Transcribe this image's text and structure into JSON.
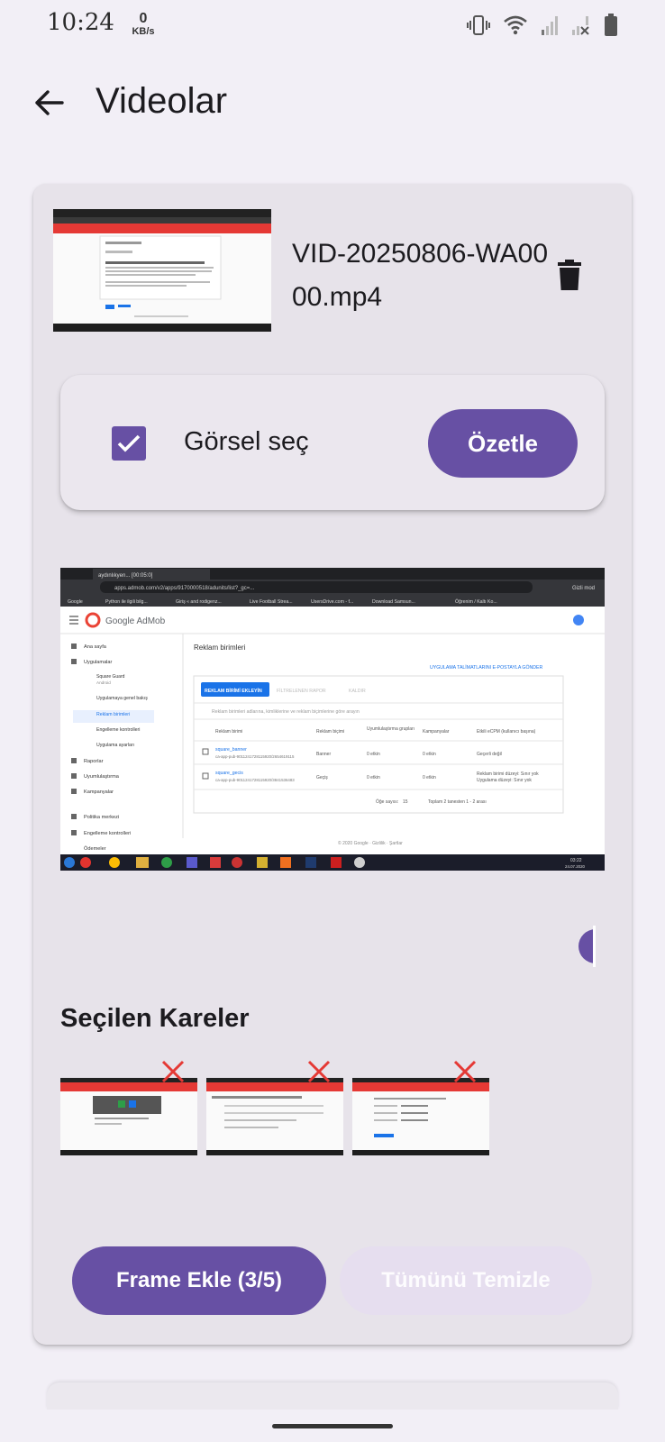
{
  "status_bar": {
    "time": "10:24",
    "net_speed_value": "0",
    "net_speed_unit": "KB/s",
    "icons": [
      "vibrate-icon",
      "wifi-icon",
      "signal-icon",
      "signal-no-service-icon",
      "battery-icon"
    ]
  },
  "app_bar": {
    "back_icon": "arrow-left-icon",
    "title": "Videolar"
  },
  "video": {
    "file_name": "VID-20250806-WA0000.mp4",
    "delete_icon": "trash-icon"
  },
  "select_panel": {
    "checkbox_checked": true,
    "checkbox_label": "Görsel seç",
    "summarize_label": "Özetle"
  },
  "frame_preview": {
    "browser_tab": "aydınlıkyen... [00:05:0]",
    "url": "apps.admob.com/v2/apps/9170000518/adunits/list?_gc=...",
    "bookmarks": [
      "Google",
      "Python ile ilgili bilg...",
      "Giriş « and rodigenz...",
      "Live Football Strea...",
      "UsersDrive.com - f...",
      "Download Samsun...",
      "Öğrenim / Kaltı Ko..."
    ],
    "logo_text": "Google AdMob",
    "profile_label": "Gizli mod",
    "nav_items": [
      "Ana sayfa",
      "Uygulamalar",
      "Square Guard",
      "Android",
      "Uygulamaya genel bakış",
      "Reklam birimleri",
      "Engelleme kontrolleri",
      "Uygulama ayarları",
      "Raporlar",
      "Uyumlulaştırma",
      "Kampanyalar",
      "Politika merkezi",
      "Engelleme kontrolleri",
      "Ödemeler"
    ],
    "page_title": "Reklam birimleri",
    "email_link": "UYGULAMA TALİMATLARINI E-POSTAYLA GÖNDER",
    "add_unit_button": "REKLAM BİRİMİ EKLEYİN",
    "filter_button": "FİLTRELENEN RAPOR",
    "delete_link": "KALDIR",
    "search_placeholder": "Reklam birimleri adlarına, kimliklerine ve reklam biçimlerine göre arayın",
    "columns": [
      "Reklam birimi",
      "Reklam biçimi",
      "Uyumlulaştırma grupları",
      "Kampanyalar",
      "Etkili eCPM (kullanıcı başına)"
    ],
    "rows": [
      [
        "square_banner",
        "ca-app-pub-9011241728115920/2654619115",
        "Banner",
        "0 etkin",
        "0 etkin",
        "Geçerli değil"
      ],
      [
        "square_gecis",
        "ca-app-pub-9011241728115920/3841536483",
        "Geçiş",
        "0 etkin",
        "0 etkin",
        "Reklam birimi düzeyi: Sınır yok"
      ]
    ],
    "row2_extra": "Uygulama düzeyi: Sınır yok",
    "per_page_label": "Öğe sayısı:",
    "per_page_value": "15",
    "pagination_text": "Toplam 2 tanesten 1 - 2 arası",
    "footer": "© 2020 Google · Gizlilik · Şartlar",
    "clock": "03:22",
    "date": "24.07.2020"
  },
  "selected_frames": {
    "title": "Seçilen Kareler",
    "items": [
      {
        "remove_icon": "close-x-icon"
      },
      {
        "remove_icon": "close-x-icon"
      },
      {
        "remove_icon": "close-x-icon"
      }
    ]
  },
  "actions": {
    "add_frame_label": "Frame Ekle (3/5)",
    "clear_all_label": "Tümünü Temizle"
  },
  "colors": {
    "primary": "#6750a4",
    "primary_disabled": "#e6deef",
    "remove_red": "#e53935",
    "card_bg": "#e7e3ea",
    "page_bg": "#f2eff6"
  }
}
